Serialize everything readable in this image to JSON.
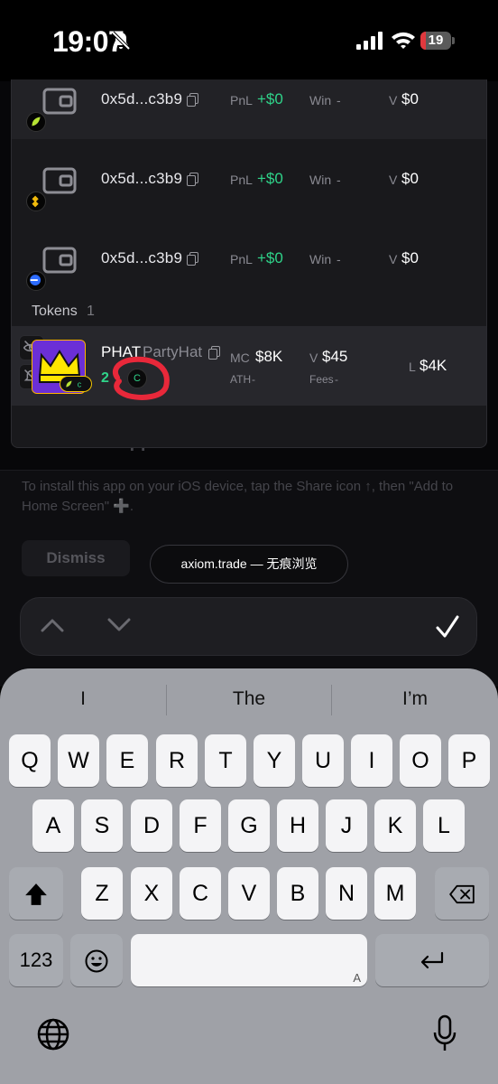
{
  "status_bar": {
    "time": "19:07",
    "battery_level": "19",
    "battery_color": "#e0393e"
  },
  "background_page": {
    "install_title": "Install WebApp",
    "install_text": "To install this app on your iOS device, tap the Share icon ↑, then \"Add to Home Screen\" ➕.",
    "dismiss_label": "Dismiss"
  },
  "wallets": [
    {
      "address": "0x5d...c3b9",
      "pnl_label": "PnL",
      "pnl_value": "+$0",
      "win_label": "Win",
      "win_value": "-",
      "vol_label": "V",
      "vol_value": "$0",
      "chain_icon": "leaf-icon"
    },
    {
      "address": "0x5d...c3b9",
      "pnl_label": "PnL",
      "pnl_value": "+$0",
      "win_label": "Win",
      "win_value": "-",
      "vol_label": "V",
      "vol_value": "$0",
      "chain_icon": "bnb-icon"
    },
    {
      "address": "0x5d...c3b9",
      "pnl_label": "PnL",
      "pnl_value": "+$0",
      "win_label": "Win",
      "win_value": "-",
      "vol_label": "V",
      "vol_value": "$0",
      "chain_icon": "base-icon"
    }
  ],
  "tokens_section": {
    "title": "Tokens",
    "count": "1"
  },
  "token": {
    "symbol": "PHAT",
    "name": "PartyHat",
    "age": "2",
    "c_badge": "C",
    "mc_label": "MC",
    "mc_value": "$8K",
    "ath_label": "ATH",
    "ath_value": "-",
    "vol_label": "V",
    "vol_value": "$45",
    "fees_label": "Fees",
    "fees_value": "-",
    "liq_label": "L",
    "liq_value": "$4K"
  },
  "browser": {
    "url_pill": "axiom.trade — 无痕浏览"
  },
  "keyboard": {
    "suggestions": [
      "I",
      "The",
      "I’m"
    ],
    "row1": [
      "Q",
      "W",
      "E",
      "R",
      "T",
      "Y",
      "U",
      "I",
      "O",
      "P"
    ],
    "row2": [
      "A",
      "S",
      "D",
      "F",
      "G",
      "H",
      "J",
      "K",
      "L"
    ],
    "row3": [
      "Z",
      "X",
      "C",
      "V",
      "B",
      "N",
      "M"
    ],
    "numbers_key": "123",
    "space_hint": "A"
  },
  "colors": {
    "positive": "#2fd48a",
    "annotation": "#e8283a"
  }
}
